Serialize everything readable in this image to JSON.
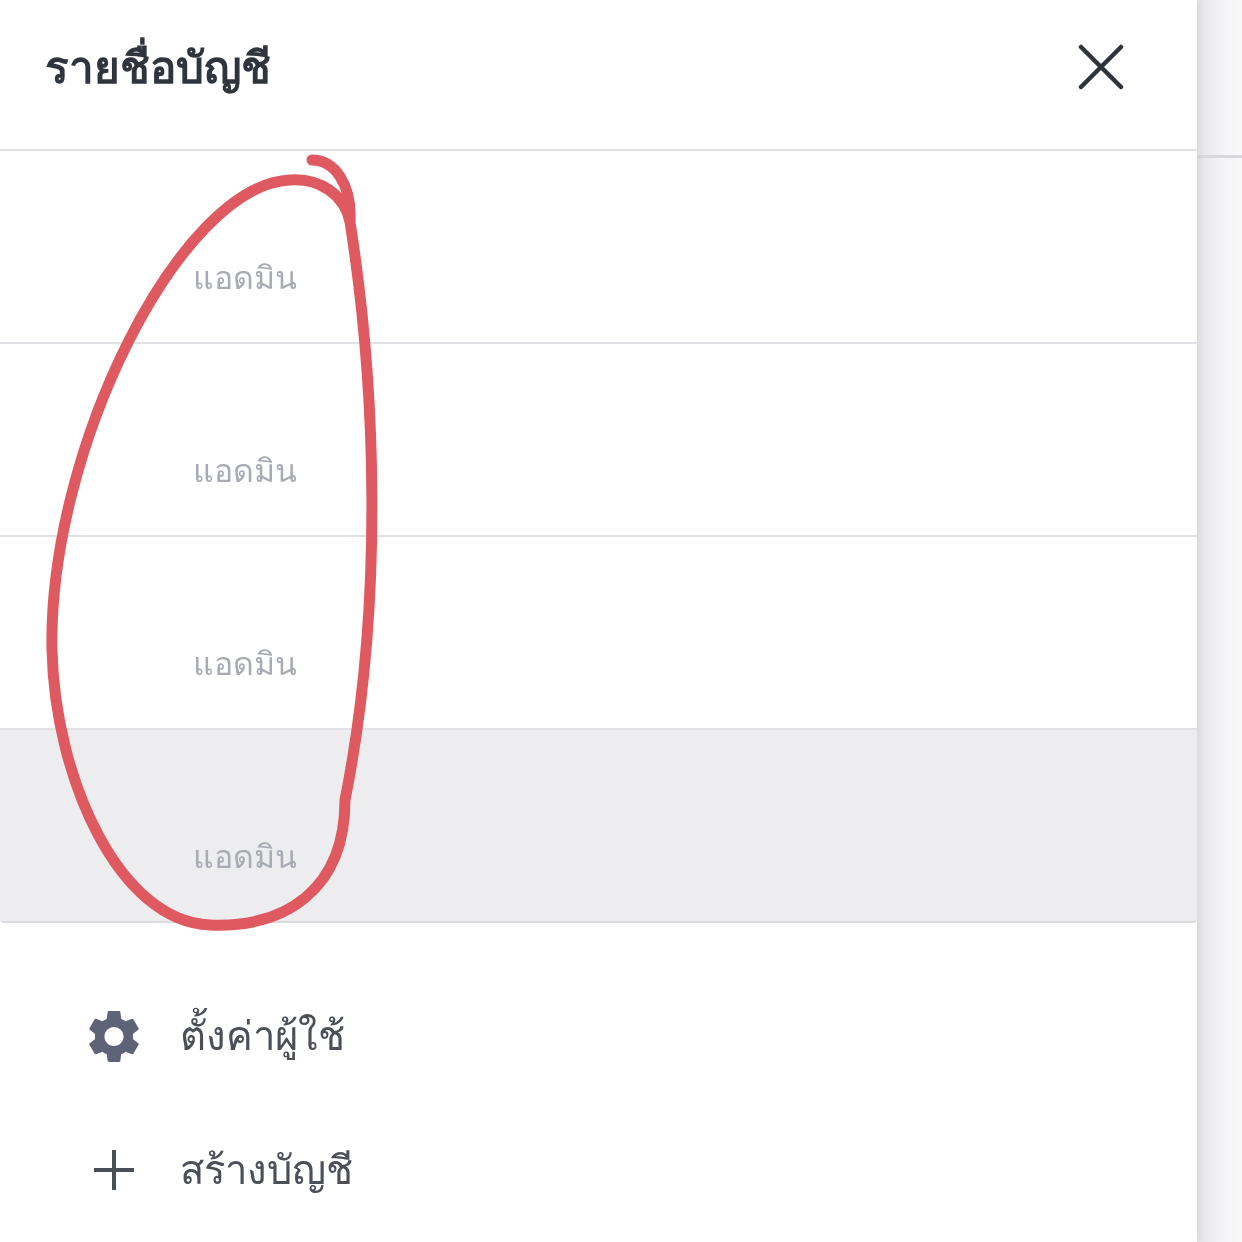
{
  "panel": {
    "title": "รายชื่อบัญชี"
  },
  "accounts": [
    {
      "role": "แอดมิน",
      "selected": false
    },
    {
      "role": "แอดมิน",
      "selected": false
    },
    {
      "role": "แอดมิน",
      "selected": false
    },
    {
      "role": "แอดมิน",
      "selected": true
    }
  ],
  "actions": [
    {
      "kind": "settings",
      "label": "ตั้งค่าผู้ใช้"
    },
    {
      "kind": "create",
      "label": "สร้างบัญชี"
    }
  ]
}
